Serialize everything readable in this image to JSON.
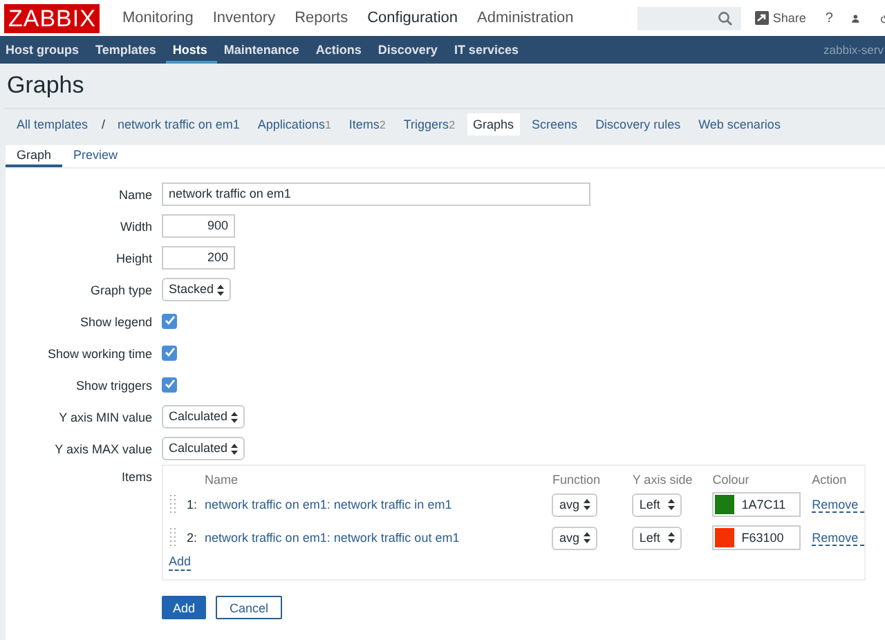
{
  "header": {
    "logo": "ZABBIX",
    "menu": [
      {
        "label": "Monitoring",
        "selected": false
      },
      {
        "label": "Inventory",
        "selected": false
      },
      {
        "label": "Reports",
        "selected": false
      },
      {
        "label": "Configuration",
        "selected": true
      },
      {
        "label": "Administration",
        "selected": false
      }
    ],
    "share": "Share",
    "help": "?"
  },
  "subnav": {
    "items": [
      {
        "label": "Host groups",
        "selected": false
      },
      {
        "label": "Templates",
        "selected": false
      },
      {
        "label": "Hosts",
        "selected": true
      },
      {
        "label": "Maintenance",
        "selected": false
      },
      {
        "label": "Actions",
        "selected": false
      },
      {
        "label": "Discovery",
        "selected": false
      },
      {
        "label": "IT services",
        "selected": false
      }
    ],
    "server": "zabbix-serv"
  },
  "title": "Graphs",
  "breadcrumbs": [
    {
      "label": "All templates",
      "selected": false
    },
    {
      "label": "/",
      "kind": "separator"
    },
    {
      "label": "network traffic on em1",
      "selected": false
    },
    {
      "label": "Applications",
      "count": "1",
      "selected": false
    },
    {
      "label": "Items",
      "count": "2",
      "selected": false
    },
    {
      "label": "Triggers",
      "count": "2",
      "selected": false
    },
    {
      "label": "Graphs",
      "selected": true
    },
    {
      "label": "Screens",
      "selected": false
    },
    {
      "label": "Discovery rules",
      "selected": false
    },
    {
      "label": "Web scenarios",
      "selected": false
    }
  ],
  "tabs": [
    {
      "label": "Graph",
      "selected": true
    },
    {
      "label": "Preview",
      "selected": false
    }
  ],
  "fields": [
    {
      "kind": "text",
      "label": "Name",
      "value": "network traffic on em1"
    },
    {
      "kind": "number",
      "label": "Width",
      "value": "900"
    },
    {
      "kind": "number",
      "label": "Height",
      "value": "200"
    },
    {
      "kind": "select",
      "label": "Graph type",
      "value": "Stacked"
    },
    {
      "kind": "checkbox",
      "label": "Show legend",
      "checked": true
    },
    {
      "kind": "checkbox",
      "label": "Show working time",
      "checked": true
    },
    {
      "kind": "checkbox",
      "label": "Show triggers",
      "checked": true
    },
    {
      "kind": "select",
      "label": "Y axis MIN value",
      "value": "Calculated"
    },
    {
      "kind": "select",
      "label": "Y axis MAX value",
      "value": "Calculated"
    }
  ],
  "items": {
    "label": "Items",
    "columns": [
      "Name",
      "Function",
      "Y axis side",
      "Colour",
      "Action"
    ],
    "rows": [
      {
        "index": "1:",
        "name": "network traffic on em1: network traffic in em1",
        "function": "avg",
        "side": "Left",
        "color": "#1a7c11",
        "colour_text": "1A7C11",
        "action": "Remove"
      },
      {
        "index": "2:",
        "name": "network traffic on em1: network traffic out em1",
        "function": "avg",
        "side": "Left",
        "color": "#f63100",
        "colour_text": "F63100",
        "action": "Remove"
      }
    ],
    "add": "Add"
  },
  "buttons": [
    {
      "label": "Add",
      "kind": "primary"
    },
    {
      "label": "Cancel",
      "kind": "secondary"
    }
  ]
}
